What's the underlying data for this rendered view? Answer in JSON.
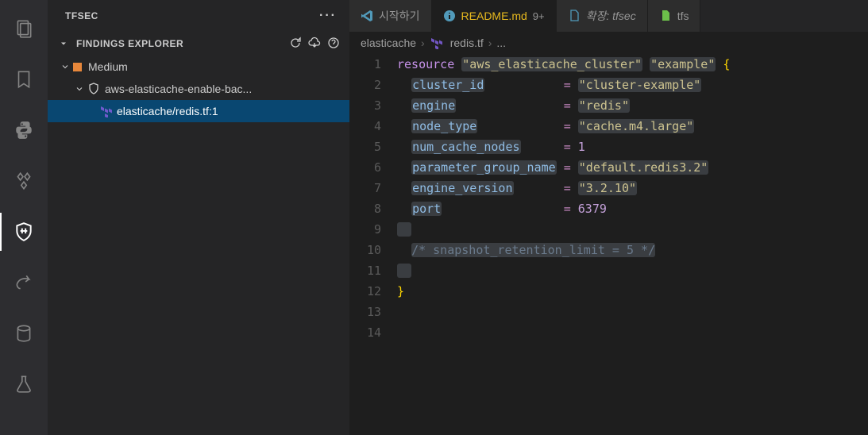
{
  "sidebar": {
    "title": "TFSEC",
    "explorer_title": "FINDINGS EXPLORER",
    "tree": {
      "severity_label": "Medium",
      "rule_label": "aws-elasticache-enable-bac...",
      "finding_label": "elasticache/redis.tf:1"
    }
  },
  "tabs": [
    {
      "label": "시작하기",
      "active": false,
      "icon": "vscode"
    },
    {
      "label": "README.md",
      "active": true,
      "modified": "9+",
      "icon": "info"
    },
    {
      "label": "확장: tfsec",
      "active": false,
      "italic": true,
      "icon": "file"
    },
    {
      "label": "tfs",
      "active": false,
      "truncated": true,
      "icon": "file-green"
    }
  ],
  "breadcrumbs": {
    "parts": [
      "elasticache",
      "redis.tf",
      "..."
    ]
  },
  "code": {
    "lines": [
      {
        "n": 1,
        "tokens": [
          [
            "kw",
            "resource"
          ],
          [
            "sp",
            " "
          ],
          [
            "str",
            "\"aws_elasticache_cluster\""
          ],
          [
            "sp",
            " "
          ],
          [
            "str",
            "\"example\""
          ],
          [
            "sp",
            " "
          ],
          [
            "brace",
            "{"
          ]
        ]
      },
      {
        "n": 2,
        "tokens": [
          [
            "indent",
            "  "
          ],
          [
            "prop",
            "cluster_id"
          ],
          [
            "pad",
            "           "
          ],
          [
            "eq",
            "="
          ],
          [
            "sp",
            " "
          ],
          [
            "str",
            "\"cluster-example\""
          ]
        ]
      },
      {
        "n": 3,
        "tokens": [
          [
            "indent",
            "  "
          ],
          [
            "prop",
            "engine"
          ],
          [
            "pad",
            "               "
          ],
          [
            "eq",
            "="
          ],
          [
            "sp",
            " "
          ],
          [
            "str",
            "\"redis\""
          ]
        ]
      },
      {
        "n": 4,
        "tokens": [
          [
            "indent",
            "  "
          ],
          [
            "prop",
            "node_type"
          ],
          [
            "pad",
            "            "
          ],
          [
            "eq",
            "="
          ],
          [
            "sp",
            " "
          ],
          [
            "str",
            "\"cache.m4.large\""
          ]
        ]
      },
      {
        "n": 5,
        "tokens": [
          [
            "indent",
            "  "
          ],
          [
            "prop",
            "num_cache_nodes"
          ],
          [
            "pad",
            "      "
          ],
          [
            "eq",
            "="
          ],
          [
            "sp",
            " "
          ],
          [
            "num",
            "1"
          ]
        ]
      },
      {
        "n": 6,
        "tokens": [
          [
            "indent",
            "  "
          ],
          [
            "prop",
            "parameter_group_name"
          ],
          [
            "pad",
            " "
          ],
          [
            "eq",
            "="
          ],
          [
            "sp",
            " "
          ],
          [
            "str",
            "\"default.redis3.2\""
          ]
        ]
      },
      {
        "n": 7,
        "tokens": [
          [
            "indent",
            "  "
          ],
          [
            "prop",
            "engine_version"
          ],
          [
            "pad",
            "       "
          ],
          [
            "eq",
            "="
          ],
          [
            "sp",
            " "
          ],
          [
            "str",
            "\"3.2.10\""
          ]
        ]
      },
      {
        "n": 8,
        "tokens": [
          [
            "indent",
            "  "
          ],
          [
            "prop",
            "port"
          ],
          [
            "pad",
            "                 "
          ],
          [
            "eq",
            "="
          ],
          [
            "sp",
            " "
          ],
          [
            "num",
            "6379"
          ]
        ]
      },
      {
        "n": 9,
        "tokens": [
          [
            "blank",
            ""
          ]
        ]
      },
      {
        "n": 10,
        "tokens": [
          [
            "indent",
            "  "
          ],
          [
            "comment",
            "/* snapshot_retention_limit = 5 */"
          ]
        ]
      },
      {
        "n": 11,
        "tokens": [
          [
            "blank",
            ""
          ]
        ]
      },
      {
        "n": 12,
        "tokens": [
          [
            "brace",
            "}"
          ]
        ]
      },
      {
        "n": 13,
        "tokens": [
          [
            "empty",
            ""
          ]
        ]
      },
      {
        "n": 14,
        "tokens": [
          [
            "empty",
            ""
          ]
        ]
      }
    ]
  }
}
